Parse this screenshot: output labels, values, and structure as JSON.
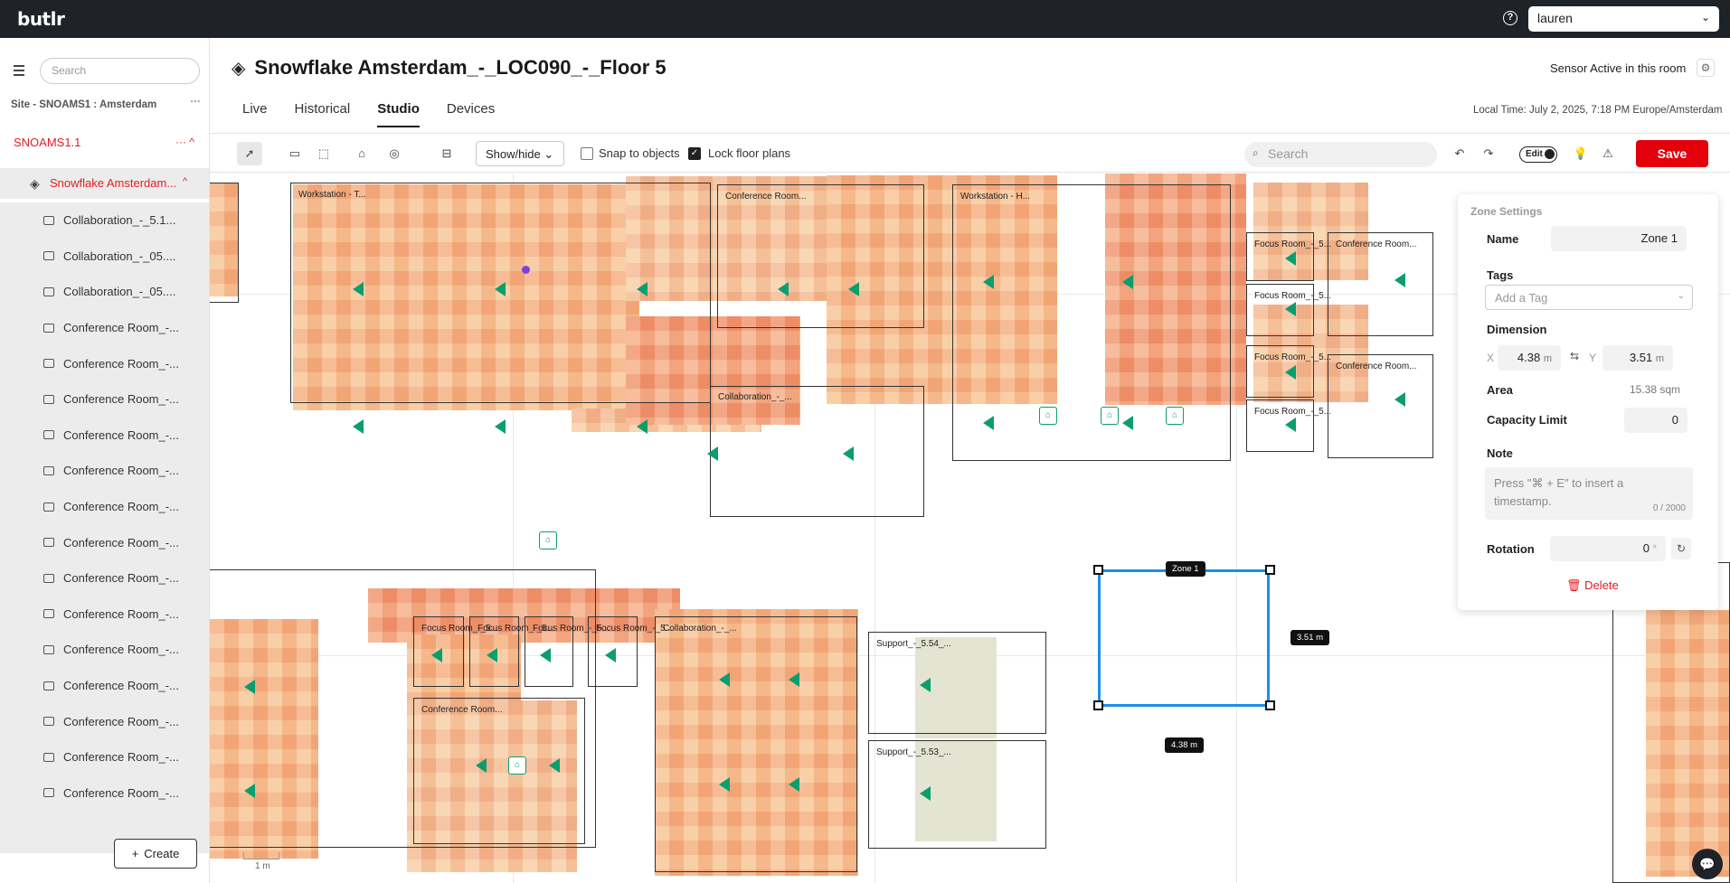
{
  "app": {
    "logo": "butlr",
    "user": "lauren"
  },
  "sidebar": {
    "search_placeholder": "Search",
    "site_label": "Site - SNOAMS1 : Amsterdam",
    "site_more": "···",
    "level1": "SNOAMS1.1",
    "level1_ctrls": "···  ^",
    "level2": "Snowflake Amsterdam...",
    "rooms": [
      "Collaboration_-_5.1...",
      "Collaboration_-_05....",
      "Collaboration_-_05....",
      "Conference Room_-...",
      "Conference Room_-...",
      "Conference Room_-...",
      "Conference Room_-...",
      "Conference Room_-...",
      "Conference Room_-...",
      "Conference Room_-...",
      "Conference Room_-...",
      "Conference Room_-...",
      "Conference Room_-...",
      "Conference Room_-...",
      "Conference Room_-...",
      "Conference Room_-...",
      "Conference Room_-..."
    ],
    "create_label": "Create"
  },
  "header": {
    "title": "Snowflake Amsterdam_-_LOC090_-_Floor 5",
    "sensor_status": "Sensor Active in this room",
    "tabs": [
      "Live",
      "Historical",
      "Studio",
      "Devices"
    ],
    "active_tab": "Studio",
    "local_time": "Local Time: July 2, 2025, 7:18 PM Europe/Amsterdam"
  },
  "toolbar": {
    "show_hide": "Show/hide",
    "snap_label": "Snap to objects",
    "snap_checked": false,
    "lock_label": "Lock floor plans",
    "lock_checked": true,
    "search_placeholder": "Search",
    "edit_label": "Edit",
    "save_label": "Save"
  },
  "canvas": {
    "zones": [
      "Workstation - T...",
      "Conference Room...",
      "Collaboration_-_...",
      "Workstation - H...",
      "Focus Room_-_5...",
      "Focus Room_-_5...",
      "Focus Room_-_5...",
      "Focus Room_-_5...",
      "Conference Room...",
      "Conference Room...",
      "Focus Room_-_5...",
      "Focus Room_-_5...",
      "Focus Room_-_5...",
      "Focus Room_-_5...",
      "Collaboration_-_...",
      "Conference Room...",
      "Support_-_5.54_...",
      "Support_-_5.53_..."
    ],
    "selected_zone_label": "Zone 1",
    "height_tag": "3.51 m",
    "width_tag": "4.38 m",
    "scale_label": "1 m"
  },
  "zone_settings": {
    "title": "Zone Settings",
    "name_label": "Name",
    "name_value": "Zone 1",
    "tags_label": "Tags",
    "tags_placeholder": "Add a Tag",
    "dimension_label": "Dimension",
    "x_label": "X",
    "x_value": "4.38",
    "x_unit": "m",
    "y_label": "Y",
    "y_value": "3.51",
    "y_unit": "m",
    "area_label": "Area",
    "area_value": "15.38 sqm",
    "capacity_label": "Capacity Limit",
    "capacity_value": "0",
    "note_label": "Note",
    "note_placeholder": "Press \"⌘ + E\" to insert a timestamp.",
    "note_count": "0 / 2000",
    "rotation_label": "Rotation",
    "rotation_value": "0",
    "rotation_unit": "°",
    "delete_label": "Delete"
  }
}
